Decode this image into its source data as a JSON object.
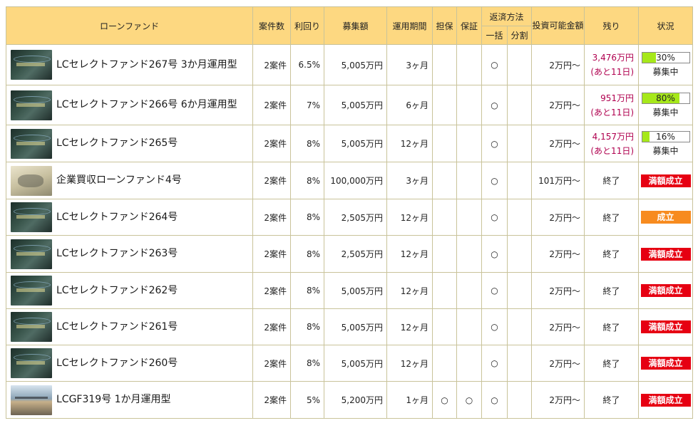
{
  "headers": {
    "fund": "ローンファンド",
    "cases": "案件数",
    "yield": "利回り",
    "amount": "募集額",
    "period": "運用期間",
    "collateral": "担保",
    "guarantee": "保証",
    "repayment": "返済方法",
    "lump": "一括",
    "installment": "分割",
    "min_invest": "投資可能金額",
    "remaining": "残り",
    "status": "状況"
  },
  "rows": [
    {
      "thumb": "lc",
      "name": "LCセレクトファンド267号 3か月運用型",
      "cases": "2案件",
      "yield": "6.5%",
      "amount": "5,005万円",
      "period": "3ヶ月",
      "collateral": "",
      "guarantee": "",
      "lump": "○",
      "installment": "",
      "min": "2万円〜",
      "remain_amount": "3,476万円",
      "remain_days": "(あと11日)",
      "progress_label": "30%",
      "progress": 0.3,
      "recruit": "募集中",
      "badge": "",
      "badge_color": ""
    },
    {
      "thumb": "lc",
      "name": "LCセレクトファンド266号 6か月運用型",
      "cases": "2案件",
      "yield": "7%",
      "amount": "5,005万円",
      "period": "6ヶ月",
      "collateral": "",
      "guarantee": "",
      "lump": "○",
      "installment": "",
      "min": "2万円〜",
      "remain_amount": "951万円",
      "remain_days": "(あと11日)",
      "progress_label": "80%",
      "progress": 0.8,
      "recruit": "募集中",
      "badge": "",
      "badge_color": ""
    },
    {
      "thumb": "lc",
      "name": "LCセレクトファンド265号",
      "cases": "2案件",
      "yield": "8%",
      "amount": "5,005万円",
      "period": "12ヶ月",
      "collateral": "",
      "guarantee": "",
      "lump": "○",
      "installment": "",
      "min": "2万円〜",
      "remain_amount": "4,157万円",
      "remain_days": "(あと11日)",
      "progress_label": "16%",
      "progress": 0.16,
      "recruit": "募集中",
      "badge": "",
      "badge_color": ""
    },
    {
      "thumb": "ma",
      "name": "企業買収ローンファンド4号",
      "cases": "2案件",
      "yield": "8%",
      "amount": "100,000万円",
      "period": "3ヶ月",
      "collateral": "",
      "guarantee": "",
      "lump": "○",
      "installment": "",
      "min": "101万円〜",
      "remain_text": "終了",
      "badge": "満額成立",
      "badge_color": "red"
    },
    {
      "thumb": "lc",
      "name": "LCセレクトファンド264号",
      "cases": "2案件",
      "yield": "8%",
      "amount": "2,505万円",
      "period": "12ヶ月",
      "collateral": "",
      "guarantee": "",
      "lump": "○",
      "installment": "",
      "min": "2万円〜",
      "remain_text": "終了",
      "badge": "成立",
      "badge_color": "orange"
    },
    {
      "thumb": "lc",
      "name": "LCセレクトファンド263号",
      "cases": "2案件",
      "yield": "8%",
      "amount": "2,505万円",
      "period": "12ヶ月",
      "collateral": "",
      "guarantee": "",
      "lump": "○",
      "installment": "",
      "min": "2万円〜",
      "remain_text": "終了",
      "badge": "満額成立",
      "badge_color": "red"
    },
    {
      "thumb": "lc",
      "name": "LCセレクトファンド262号",
      "cases": "2案件",
      "yield": "8%",
      "amount": "5,005万円",
      "period": "12ヶ月",
      "collateral": "",
      "guarantee": "",
      "lump": "○",
      "installment": "",
      "min": "2万円〜",
      "remain_text": "終了",
      "badge": "満額成立",
      "badge_color": "red"
    },
    {
      "thumb": "lc",
      "name": "LCセレクトファンド261号",
      "cases": "2案件",
      "yield": "8%",
      "amount": "5,005万円",
      "period": "12ヶ月",
      "collateral": "",
      "guarantee": "",
      "lump": "○",
      "installment": "",
      "min": "2万円〜",
      "remain_text": "終了",
      "badge": "満額成立",
      "badge_color": "red"
    },
    {
      "thumb": "lc",
      "name": "LCセレクトファンド260号",
      "cases": "2案件",
      "yield": "8%",
      "amount": "5,005万円",
      "period": "12ヶ月",
      "collateral": "",
      "guarantee": "",
      "lump": "○",
      "installment": "",
      "min": "2万円〜",
      "remain_text": "終了",
      "badge": "満額成立",
      "badge_color": "red"
    },
    {
      "thumb": "cgf",
      "name": "LCGF319号 1か月運用型",
      "cases": "2案件",
      "yield": "5%",
      "amount": "5,200万円",
      "period": "1ヶ月",
      "collateral": "○",
      "guarantee": "○",
      "lump": "○",
      "installment": "",
      "min": "2万円〜",
      "remain_text": "終了",
      "badge": "満額成立",
      "badge_color": "red"
    }
  ]
}
